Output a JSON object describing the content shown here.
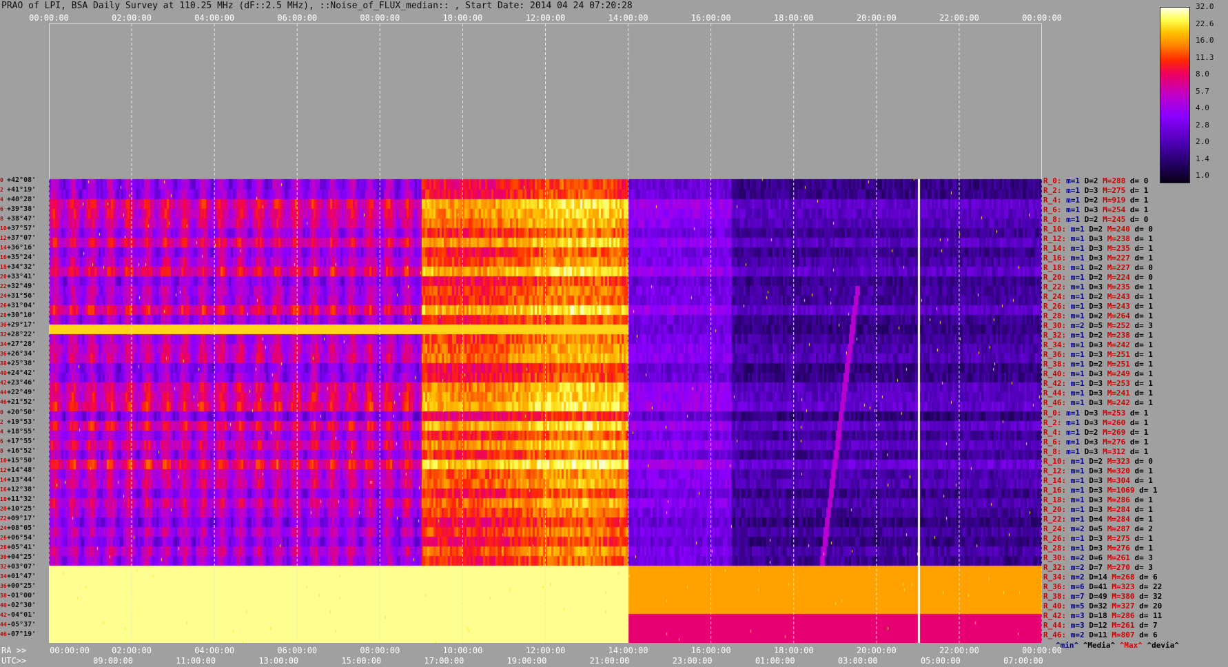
{
  "title": "PRAO of LPI, BSA Daily Survey at 110.25 MHz (dF::2.5 MHz), ::Noise_of_FLUX_median:: , Start Date: 2014 04 24 07:20:28",
  "ra_axis": {
    "prefix": "RA >>",
    "ticks": [
      "00:00:00",
      "02:00:00",
      "04:00:00",
      "06:00:00",
      "08:00:00",
      "10:00:00",
      "12:00:00",
      "14:00:00",
      "16:00:00",
      "18:00:00",
      "20:00:00",
      "22:00:00",
      "00:00:00"
    ]
  },
  "utc_axis": {
    "prefix": "UTC>>",
    "ticks": [
      "09:00:00",
      "11:00:00",
      "13:00:00",
      "15:00:00",
      "17:00:00",
      "19:00:00",
      "21:00:00",
      "23:00:00",
      "01:00:00",
      "03:00:00",
      "05:00:00",
      "07:00:00"
    ]
  },
  "colorbar": {
    "labels": [
      "32.0",
      "22.6",
      "16.0",
      "11.3",
      "8.0",
      "5.7",
      "4.0",
      "2.8",
      "2.0",
      "1.4",
      "1.0"
    ],
    "colors": [
      "#0a0018",
      "#4a00b0",
      "#8a00ff",
      "#c000c8",
      "#ee0060",
      "#ff2a00",
      "#ff8000",
      "#ffc400",
      "#ffff50",
      "#ffffe8"
    ]
  },
  "legend": {
    "min": "^min^",
    "median": "^Media^",
    "max": "^Max^",
    "devia": "^devia^"
  },
  "rows": [
    {
      "idx": "0",
      "dec": "+42°08'",
      "r": "R_0:",
      "m": "m=1",
      "D": "D=2",
      "M": "M=288",
      "d": "d= 0"
    },
    {
      "idx": "2",
      "dec": "+41°19'",
      "r": "R_2:",
      "m": "m=1",
      "D": "D=3",
      "M": "M=275",
      "d": "d= 1"
    },
    {
      "idx": "4",
      "dec": "+40°28'",
      "r": "R_4:",
      "m": "m=1",
      "D": "D=2",
      "M": "M=919",
      "d": "d= 1"
    },
    {
      "idx": "6",
      "dec": "+39°38'",
      "r": "R_6:",
      "m": "m=1",
      "D": "D=3",
      "M": "M=254",
      "d": "d= 1"
    },
    {
      "idx": "8",
      "dec": "+38°47'",
      "r": "R_8:",
      "m": "m=1",
      "D": "D=2",
      "M": "M=245",
      "d": "d= 0"
    },
    {
      "idx": "10",
      "dec": "+37°57'",
      "r": "R_10:",
      "m": "m=1",
      "D": "D=2",
      "M": "M=240",
      "d": "d= 0"
    },
    {
      "idx": "12",
      "dec": "+37°07'",
      "r": "R_12:",
      "m": "m=1",
      "D": "D=3",
      "M": "M=238",
      "d": "d= 1"
    },
    {
      "idx": "14",
      "dec": "+36°16'",
      "r": "R_14:",
      "m": "m=1",
      "D": "D=3",
      "M": "M=235",
      "d": "d= 1"
    },
    {
      "idx": "16",
      "dec": "+35°24'",
      "r": "R_16:",
      "m": "m=1",
      "D": "D=3",
      "M": "M=227",
      "d": "d= 1"
    },
    {
      "idx": "18",
      "dec": "+34°32'",
      "r": "R_18:",
      "m": "m=1",
      "D": "D=2",
      "M": "M=227",
      "d": "d= 0"
    },
    {
      "idx": "20",
      "dec": "+33°41'",
      "r": "R_20:",
      "m": "m=1",
      "D": "D=2",
      "M": "M=224",
      "d": "d= 0"
    },
    {
      "idx": "22",
      "dec": "+32°49'",
      "r": "R_22:",
      "m": "m=1",
      "D": "D=3",
      "M": "M=235",
      "d": "d= 1"
    },
    {
      "idx": "24",
      "dec": "+31°56'",
      "r": "R_24:",
      "m": "m=1",
      "D": "D=2",
      "M": "M=243",
      "d": "d= 1"
    },
    {
      "idx": "26",
      "dec": "+31°04'",
      "r": "R_26:",
      "m": "m=1",
      "D": "D=3",
      "M": "M=243",
      "d": "d= 1"
    },
    {
      "idx": "28",
      "dec": "+30°10'",
      "r": "R_28:",
      "m": "m=1",
      "D": "D=2",
      "M": "M=264",
      "d": "d= 1"
    },
    {
      "idx": "30",
      "dec": "+29°17'",
      "r": "R_30:",
      "m": "m=2",
      "D": "D=5",
      "M": "M=252",
      "d": "d= 3"
    },
    {
      "idx": "32",
      "dec": "+28°22'",
      "r": "R_32:",
      "m": "m=1",
      "D": "D=2",
      "M": "M=238",
      "d": "d= 1"
    },
    {
      "idx": "34",
      "dec": "+27°28'",
      "r": "R_34:",
      "m": "m=1",
      "D": "D=3",
      "M": "M=242",
      "d": "d= 1"
    },
    {
      "idx": "36",
      "dec": "+26°34'",
      "r": "R_36:",
      "m": "m=1",
      "D": "D=3",
      "M": "M=251",
      "d": "d= 1"
    },
    {
      "idx": "38",
      "dec": "+25°38'",
      "r": "R_38:",
      "m": "m=1",
      "D": "D=2",
      "M": "M=251",
      "d": "d= 1"
    },
    {
      "idx": "40",
      "dec": "+24°42'",
      "r": "R_40:",
      "m": "m=1",
      "D": "D=3",
      "M": "M=249",
      "d": "d= 1"
    },
    {
      "idx": "42",
      "dec": "+23°46'",
      "r": "R_42:",
      "m": "m=1",
      "D": "D=3",
      "M": "M=253",
      "d": "d= 1"
    },
    {
      "idx": "44",
      "dec": "+22°49'",
      "r": "R_44:",
      "m": "m=1",
      "D": "D=3",
      "M": "M=241",
      "d": "d= 1"
    },
    {
      "idx": "46",
      "dec": "+21°52'",
      "r": "R_46:",
      "m": "m=1",
      "D": "D=3",
      "M": "M=242",
      "d": "d= 1"
    },
    {
      "idx": "0",
      "dec": "+20°50'",
      "r": "R_0:",
      "m": "m=1",
      "D": "D=3",
      "M": "M=253",
      "d": "d= 1"
    },
    {
      "idx": "2",
      "dec": "+19°53'",
      "r": "R_2:",
      "m": "m=1",
      "D": "D=3",
      "M": "M=260",
      "d": "d= 1"
    },
    {
      "idx": "4",
      "dec": "+18°55'",
      "r": "R_4:",
      "m": "m=1",
      "D": "D=2",
      "M": "M=269",
      "d": "d= 1"
    },
    {
      "idx": "6",
      "dec": "+17°55'",
      "r": "R_6:",
      "m": "m=1",
      "D": "D=3",
      "M": "M=276",
      "d": "d= 1"
    },
    {
      "idx": "8",
      "dec": "+16°52'",
      "r": "R_8:",
      "m": "m=1",
      "D": "D=3",
      "M": "M=312",
      "d": "d= 1"
    },
    {
      "idx": "10",
      "dec": "+15°50'",
      "r": "R_10:",
      "m": "m=1",
      "D": "D=2",
      "M": "M=323",
      "d": "d= 0"
    },
    {
      "idx": "12",
      "dec": "+14°48'",
      "r": "R_12:",
      "m": "m=1",
      "D": "D=3",
      "M": "M=320",
      "d": "d= 1"
    },
    {
      "idx": "14",
      "dec": "+13°44'",
      "r": "R_14:",
      "m": "m=1",
      "D": "D=3",
      "M": "M=304",
      "d": "d= 1"
    },
    {
      "idx": "16",
      "dec": "+12°38'",
      "r": "R_16:",
      "m": "m=1",
      "D": "D=3",
      "M": "M=1069",
      "d": "d= 1"
    },
    {
      "idx": "18",
      "dec": "+11°32'",
      "r": "R_18:",
      "m": "m=1",
      "D": "D=3",
      "M": "M=286",
      "d": "d= 1"
    },
    {
      "idx": "20",
      "dec": "+10°25'",
      "r": "R_20:",
      "m": "m=1",
      "D": "D=3",
      "M": "M=284",
      "d": "d= 1"
    },
    {
      "idx": "22",
      "dec": "+09°17'",
      "r": "R_22:",
      "m": "m=1",
      "D": "D=4",
      "M": "M=284",
      "d": "d= 1"
    },
    {
      "idx": "24",
      "dec": "+08°05'",
      "r": "R_24:",
      "m": "m=2",
      "D": "D=5",
      "M": "M=287",
      "d": "d= 2"
    },
    {
      "idx": "26",
      "dec": "+06°54'",
      "r": "R_26:",
      "m": "m=1",
      "D": "D=3",
      "M": "M=275",
      "d": "d= 1"
    },
    {
      "idx": "28",
      "dec": "+05°41'",
      "r": "R_28:",
      "m": "m=1",
      "D": "D=3",
      "M": "M=276",
      "d": "d= 1"
    },
    {
      "idx": "30",
      "dec": "+04°25'",
      "r": "R_30:",
      "m": "m=2",
      "D": "D=6",
      "M": "M=261",
      "d": "d= 3"
    },
    {
      "idx": "32",
      "dec": "+03°07'",
      "r": "R_32:",
      "m": "m=2",
      "D": "D=7",
      "M": "M=270",
      "d": "d= 3"
    },
    {
      "idx": "34",
      "dec": "+01°47'",
      "r": "R_34:",
      "m": "m=2",
      "D": "D=14",
      "M": "M=268",
      "d": "d= 6"
    },
    {
      "idx": "36",
      "dec": "+00°25'",
      "r": "R_36:",
      "m": "m=6",
      "D": "D=41",
      "M": "M=323",
      "d": "d= 22"
    },
    {
      "idx": "38",
      "dec": "-01°00'",
      "r": "R_38:",
      "m": "m=7",
      "D": "D=49",
      "M": "M=380",
      "d": "d= 32"
    },
    {
      "idx": "40",
      "dec": "-02°30'",
      "r": "R_40:",
      "m": "m=5",
      "D": "D=32",
      "M": "M=327",
      "d": "d= 20"
    },
    {
      "idx": "42",
      "dec": "-04°01'",
      "r": "R_42:",
      "m": "m=3",
      "D": "D=18",
      "M": "M=286",
      "d": "d= 11"
    },
    {
      "idx": "44",
      "dec": "-05°37'",
      "r": "R_44:",
      "m": "m=3",
      "D": "D=12",
      "M": "M=261",
      "d": "d= 7"
    },
    {
      "idx": "46",
      "dec": "-07°19'",
      "r": "R_46:",
      "m": "m=2",
      "D": "D=11",
      "M": "M=807",
      "d": "d= 6"
    }
  ],
  "chart_data": {
    "type": "heatmap",
    "x_axis_top": [
      "00:00:00",
      "02:00:00",
      "04:00:00",
      "06:00:00",
      "08:00:00",
      "10:00:00",
      "12:00:00",
      "14:00:00",
      "16:00:00",
      "18:00:00",
      "20:00:00",
      "22:00:00",
      "00:00:00"
    ],
    "x_axis_bottom_ra": [
      "00:00:00",
      "02:00:00",
      "04:00:00",
      "06:00:00",
      "08:00:00",
      "10:00:00",
      "12:00:00",
      "14:00:00",
      "16:00:00",
      "18:00:00",
      "20:00:00",
      "22:00:00",
      "00:00:00"
    ],
    "x_axis_bottom_utc": [
      "09:00:00",
      "11:00:00",
      "13:00:00",
      "15:00:00",
      "17:00:00",
      "19:00:00",
      "21:00:00",
      "23:00:00",
      "01:00:00",
      "03:00:00",
      "05:00:00",
      "07:00:00"
    ],
    "ra_range_hours": [
      0,
      24
    ],
    "colorscale": "log",
    "zlim": [
      1.0,
      32.0
    ],
    "colorbar_ticks": [
      32.0,
      22.6,
      16.0,
      11.3,
      8.0,
      5.7,
      4.0,
      2.8,
      2.0,
      1.4,
      1.0
    ],
    "n_rows": 48,
    "legend_placement": "bottom-right",
    "grid": true
  }
}
